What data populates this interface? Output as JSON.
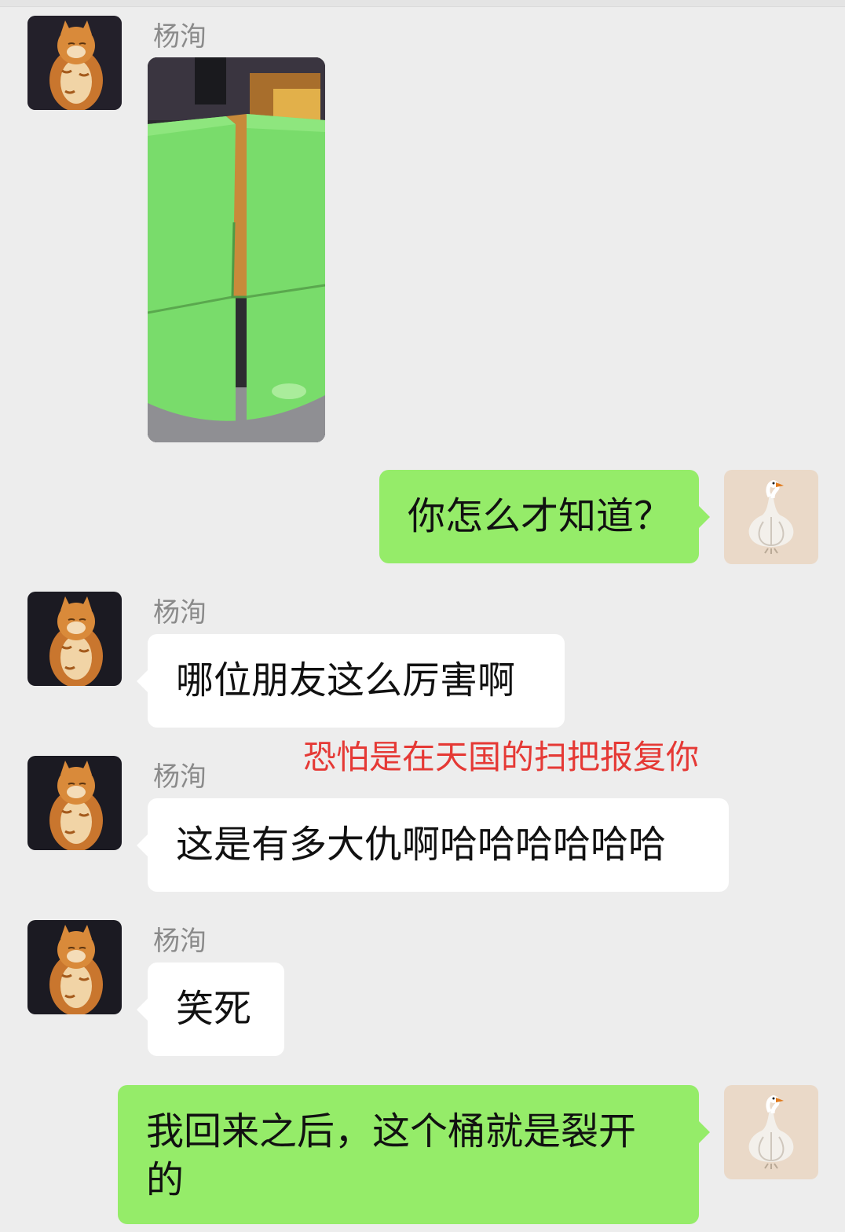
{
  "chat": {
    "messages": [
      {
        "sender": "杨洵",
        "type": "image",
        "image_desc": "green-bucket-cracked"
      },
      {
        "type": "text",
        "direction": "out",
        "text": "你怎么才知道？"
      },
      {
        "sender": "杨洵",
        "type": "text",
        "direction": "in",
        "text": "哪位朋友这么厉害啊"
      },
      {
        "sender": "杨洵",
        "type": "text",
        "direction": "in",
        "text": "这是有多大仇啊哈哈哈哈哈哈"
      },
      {
        "sender": "杨洵",
        "type": "text",
        "direction": "in",
        "text": "笑死"
      },
      {
        "type": "text",
        "direction": "out",
        "text": "我回来之后，这个桶就是裂开的"
      }
    ]
  },
  "annotation": {
    "text": "恐怕是在天国的扫把报复你",
    "color": "#e53935"
  },
  "colors": {
    "background": "#ededed",
    "bubble_in": "#ffffff",
    "bubble_out": "#95ec69",
    "bucket_green": "#79dc6b"
  },
  "icons": {
    "contact_avatar": "orange-cat-avatar-icon",
    "self_avatar": "garlic-swan-avatar-icon"
  }
}
